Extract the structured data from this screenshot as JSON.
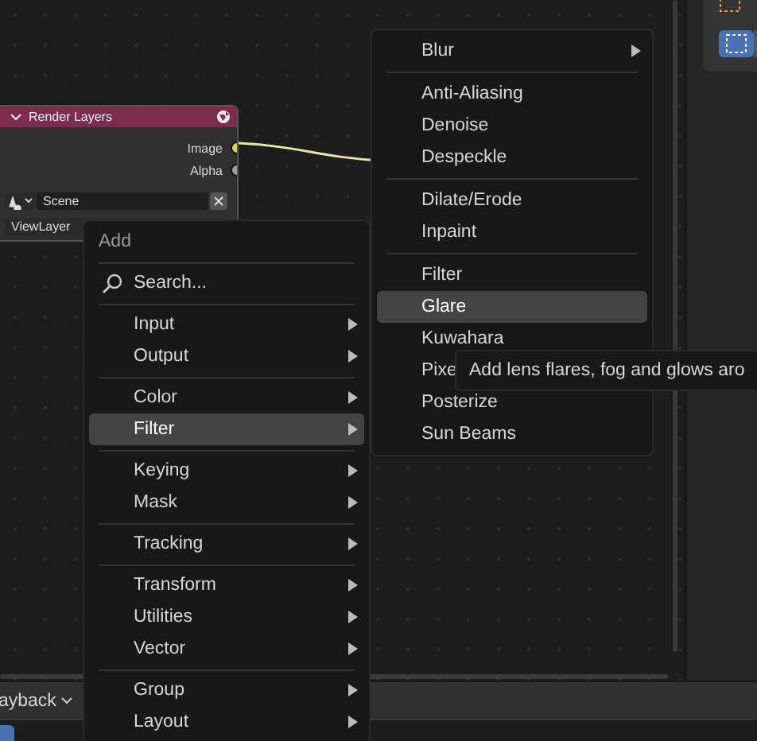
{
  "node_editor": {
    "node": {
      "title": "Render Layers",
      "outputs": [
        {
          "label": "Image",
          "color": "#d6d63a"
        },
        {
          "label": "Alpha",
          "color": "#a1a1a1"
        }
      ],
      "scene_field": {
        "value": "Scene"
      },
      "view_layer_field": {
        "value": "ViewLayer"
      }
    }
  },
  "add_menu": {
    "title": "Add",
    "search": {
      "label": "Search..."
    },
    "groups": [
      [
        {
          "label": "Input",
          "submenu": true,
          "selected": false
        },
        {
          "label": "Output",
          "submenu": true,
          "selected": false
        }
      ],
      [
        {
          "label": "Color",
          "submenu": true,
          "selected": false
        },
        {
          "label": "Filter",
          "submenu": true,
          "selected": true
        }
      ],
      [
        {
          "label": "Keying",
          "submenu": true,
          "selected": false
        },
        {
          "label": "Mask",
          "submenu": true,
          "selected": false
        }
      ],
      [
        {
          "label": "Tracking",
          "submenu": true,
          "selected": false
        }
      ],
      [
        {
          "label": "Transform",
          "submenu": true,
          "selected": false
        },
        {
          "label": "Utilities",
          "submenu": true,
          "selected": false
        },
        {
          "label": "Vector",
          "submenu": true,
          "selected": false
        }
      ],
      [
        {
          "label": "Group",
          "submenu": true,
          "selected": false
        },
        {
          "label": "Layout",
          "submenu": true,
          "selected": false
        }
      ]
    ]
  },
  "filter_submenu": {
    "groups": [
      [
        {
          "label": "Blur",
          "submenu": true,
          "selected": false
        }
      ],
      [
        {
          "label": "Anti-Aliasing",
          "selected": false
        },
        {
          "label": "Denoise",
          "selected": false
        },
        {
          "label": "Despeckle",
          "selected": false
        }
      ],
      [
        {
          "label": "Dilate/Erode",
          "selected": false
        },
        {
          "label": "Inpaint",
          "selected": false
        }
      ],
      [
        {
          "label": "Filter",
          "selected": false
        },
        {
          "label": "Glare",
          "selected": true
        },
        {
          "label": "Kuwahara",
          "selected": false
        },
        {
          "label": "Pixe",
          "selected": false
        },
        {
          "label": "Posterize",
          "selected": false
        },
        {
          "label": "Sun Beams",
          "selected": false
        }
      ]
    ]
  },
  "tooltip": {
    "text": "Add lens flares, fog and glows aro"
  },
  "footer": {
    "dropdown": {
      "value": "ayback"
    }
  }
}
